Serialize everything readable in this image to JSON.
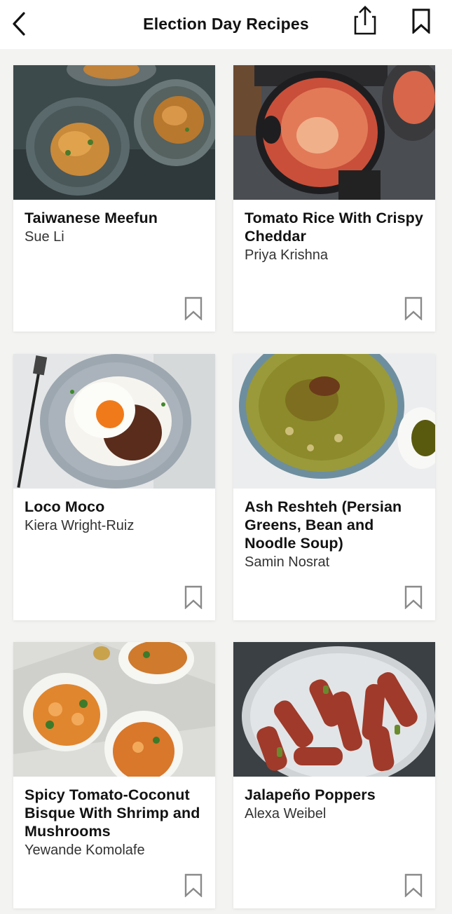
{
  "header": {
    "title": "Election Day Recipes",
    "back_icon": "chevron-left-icon",
    "share_icon": "share-icon",
    "bookmark_icon": "bookmark-icon"
  },
  "recipes": [
    {
      "title": "Taiwanese Meefun",
      "author": "Sue Li"
    },
    {
      "title": "Tomato Rice With Crispy Cheddar",
      "author": "Priya Krishna"
    },
    {
      "title": "Loco Moco",
      "author": "Kiera Wright-Ruiz"
    },
    {
      "title": "Ash Reshteh (Persian Greens, Bean and Noodle Soup)",
      "author": "Samin Nosrat"
    },
    {
      "title": "Spicy Tomato-Coconut Bisque With Shrimp and Mushrooms",
      "author": "Yewande Komolafe"
    },
    {
      "title": "Jalapeño Poppers",
      "author": "Alexa Weibel"
    }
  ],
  "colors": {
    "background": "#f3f3f1",
    "text": "#121212",
    "icon": "#333333",
    "bookmark_outline": "#8a8a8a"
  }
}
